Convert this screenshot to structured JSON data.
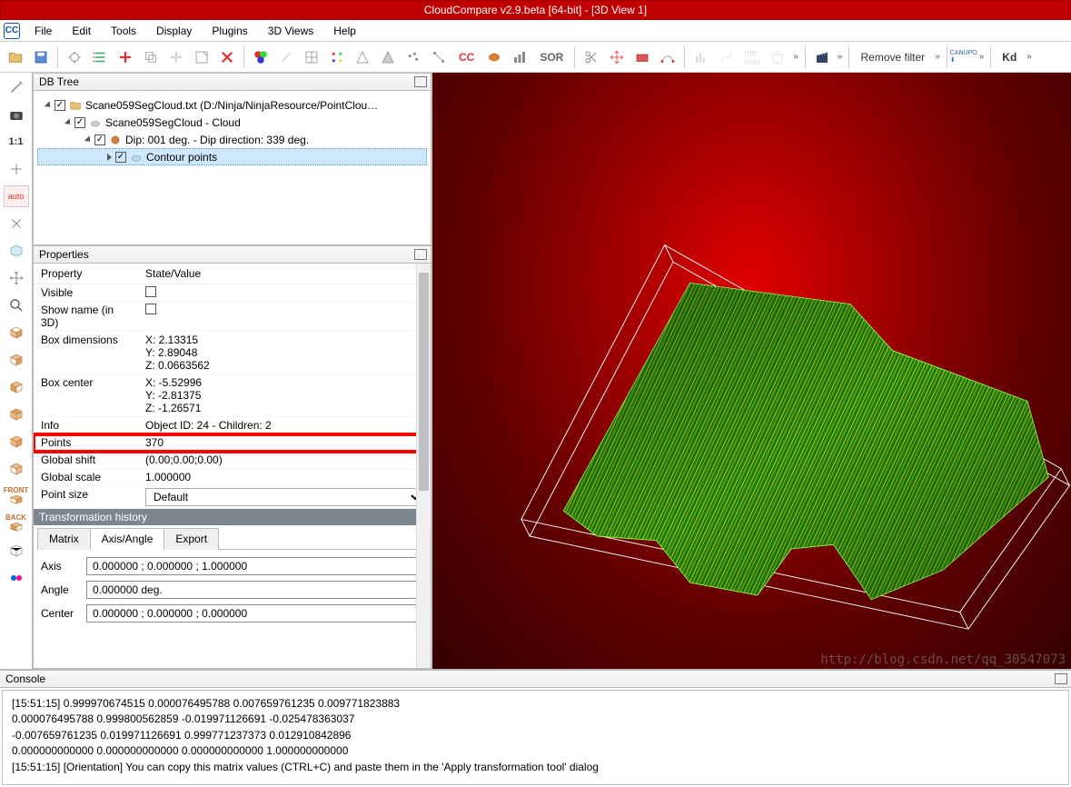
{
  "title": "CloudCompare v2.9.beta [64-bit] - [3D View 1]",
  "menu": [
    "File",
    "Edit",
    "Tools",
    "Display",
    "Plugins",
    "3D Views",
    "Help"
  ],
  "toolbar_text": {
    "sor": "SOR",
    "cc": "CC",
    "removeFilter": "Remove filter",
    "kd": "Kd"
  },
  "leftTools": {
    "oneone": "1:1",
    "auto": "auto",
    "front": "FRONT",
    "back": "BACK"
  },
  "dbTree": {
    "title": "DB Tree",
    "items": [
      {
        "indent": 0,
        "open": true,
        "checked": true,
        "icon": "folder",
        "label": "Scane059SegCloud.txt (D:/Ninja/NinjaResource/PointClou…"
      },
      {
        "indent": 1,
        "open": true,
        "checked": true,
        "icon": "cloud",
        "label": "Scane059SegCloud - Cloud"
      },
      {
        "indent": 2,
        "open": true,
        "checked": true,
        "icon": "dip",
        "label": "Dip: 001 deg. - Dip direction: 339 deg."
      },
      {
        "indent": 3,
        "open": false,
        "checked": true,
        "icon": "contour",
        "label": "Contour points",
        "selected": true
      }
    ]
  },
  "properties": {
    "title": "Properties",
    "headers": {
      "k": "Property",
      "v": "State/Value"
    },
    "rows": [
      {
        "k": "Visible",
        "v": "",
        "checkbox": true,
        "checked": false
      },
      {
        "k": "Show name (in 3D)",
        "v": "",
        "checkbox": true,
        "checked": false
      },
      {
        "k": "Box dimensions",
        "v": "X: 2.13315\nY: 2.89048\nZ: 0.0663562"
      },
      {
        "k": "Box center",
        "v": "X: -5.52996\nY: -2.81375\nZ: -1.26571"
      },
      {
        "k": "Info",
        "v": "Object ID: 24 - Children: 2"
      },
      {
        "k": "Points",
        "v": "370",
        "highlight": true
      },
      {
        "k": "Global shift",
        "v": "(0.00;0.00;0.00)"
      },
      {
        "k": "Global scale",
        "v": "1.000000"
      },
      {
        "k": "Point size",
        "v": "Default",
        "select": true
      }
    ],
    "transformSection": "Transformation history",
    "tabs": [
      "Matrix",
      "Axis/Angle",
      "Export"
    ],
    "activeTab": 1,
    "axis": "0.000000 ; 0.000000 ; 1.000000",
    "angle": "0.000000 deg.",
    "center": "0.000000 ; 0.000000 ; 0.000000",
    "labels": {
      "axis": "Axis",
      "angle": "Angle",
      "center": "Center"
    }
  },
  "console": {
    "title": "Console",
    "lines": [
      "[15:51:15] 0.999970674515 0.000076495788 0.007659761235 0.009771823883",
      "0.000076495788 0.999800562859 -0.019971126691 -0.025478363037",
      "-0.007659761235 0.019971126691 0.999771237373 0.012910842896",
      "0.000000000000 0.000000000000 0.000000000000 1.000000000000",
      "[15:51:15] [Orientation] You can copy this matrix values (CTRL+C) and paste them in the 'Apply transformation tool' dialog"
    ]
  },
  "watermark": "http://blog.csdn.net/qq_30547073"
}
